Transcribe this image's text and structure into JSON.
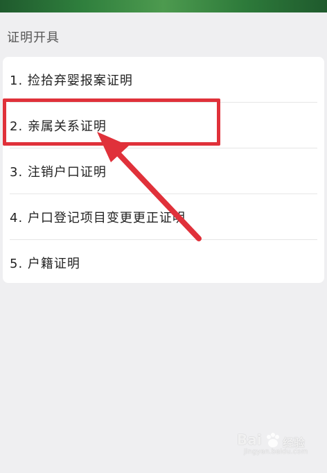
{
  "section": {
    "title": "证明开具"
  },
  "items": [
    {
      "label": "1. 捡拾弃婴报案证明"
    },
    {
      "label": "2. 亲属关系证明"
    },
    {
      "label": "3. 注销户口证明"
    },
    {
      "label": "4. 户口登记项目变更更正证明"
    },
    {
      "label": "5. 户籍证明"
    }
  ],
  "colors": {
    "highlight": "#e0313a",
    "background": "#efeff1",
    "card": "#ffffff"
  },
  "watermark": {
    "brand": "Bai",
    "brand2": "经验",
    "url": "jingyan.baidu.com"
  }
}
